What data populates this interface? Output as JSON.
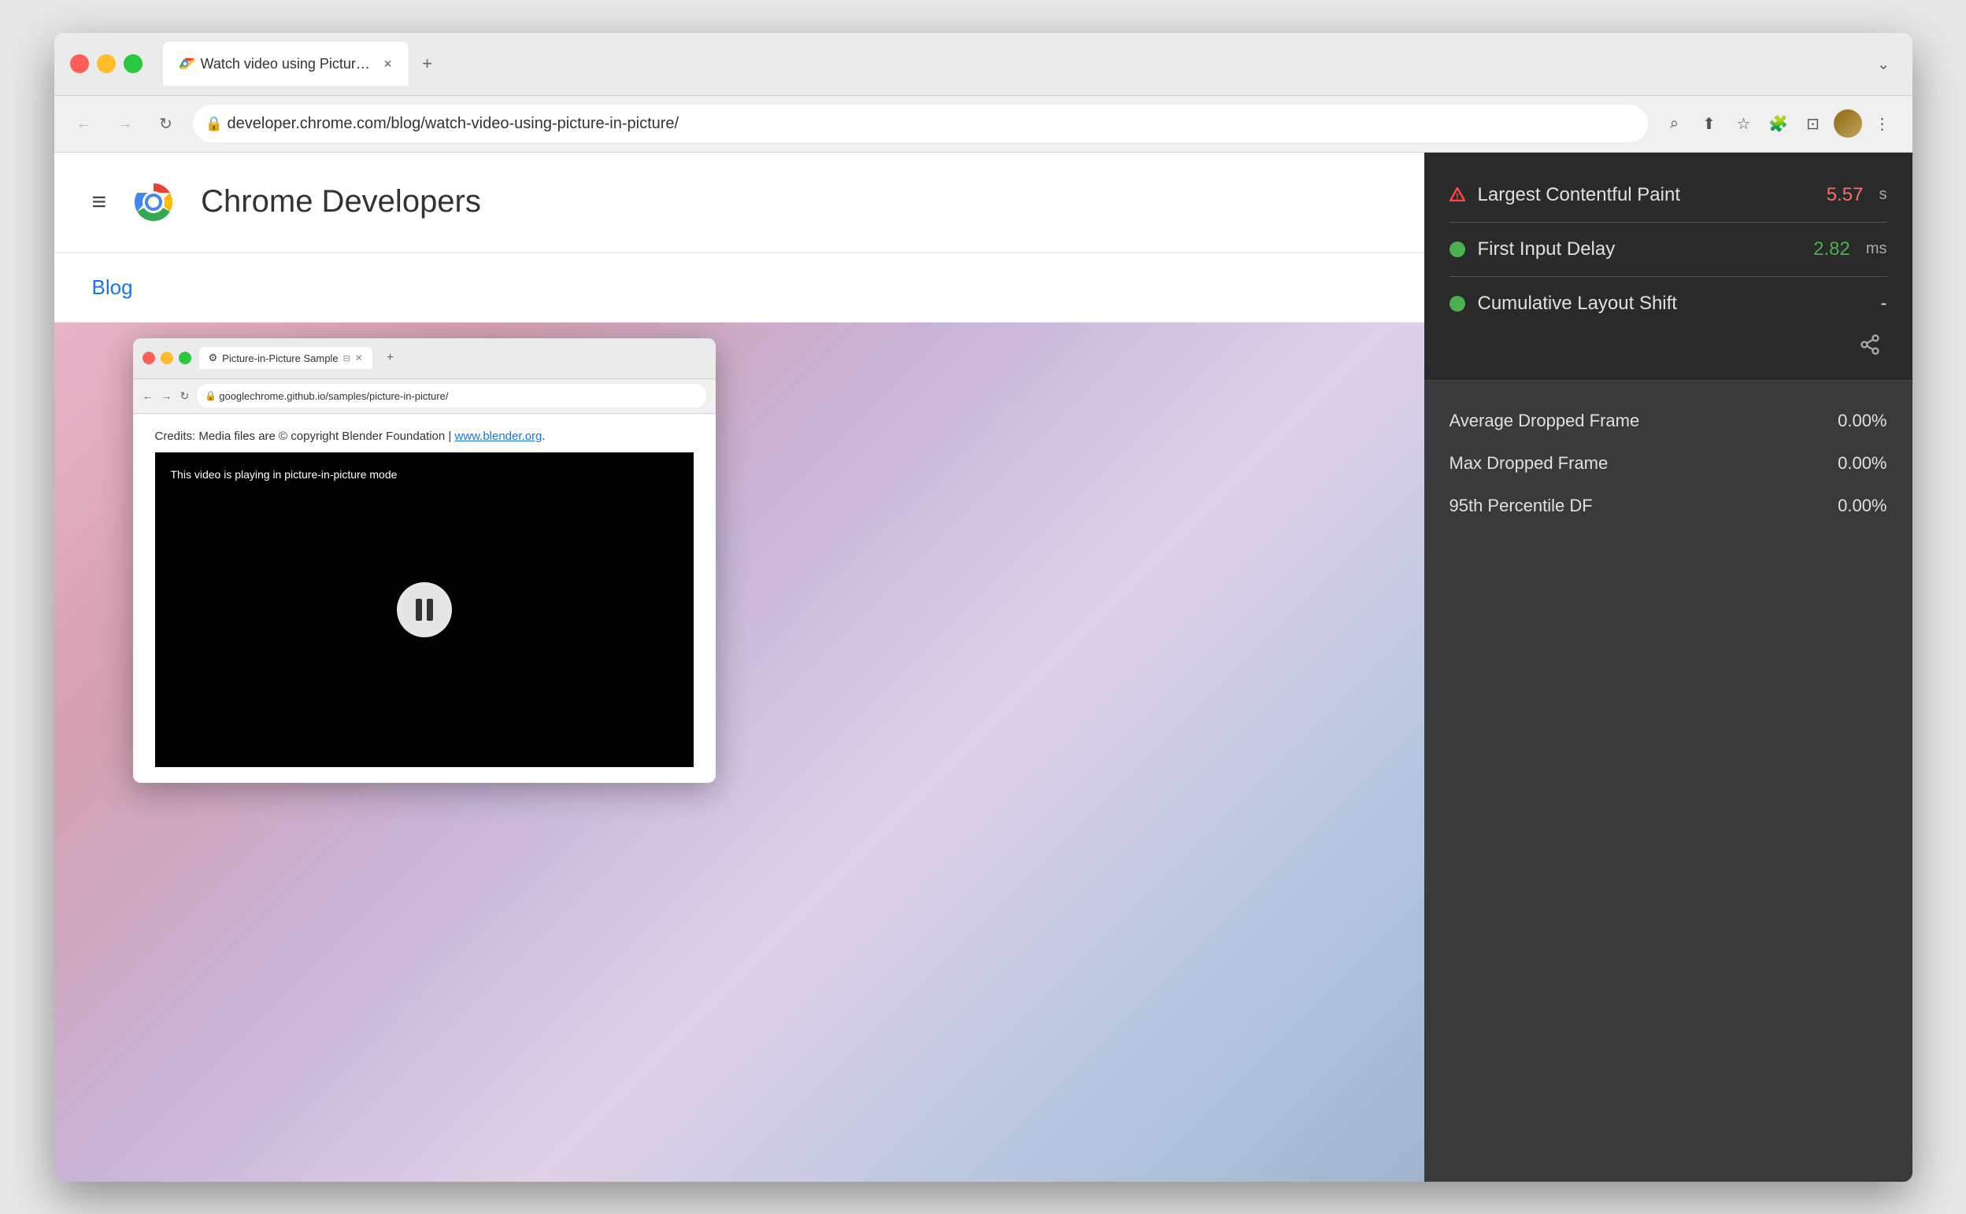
{
  "browser": {
    "tab": {
      "title": "Watch video using Picture-in-P",
      "favicon": "chrome"
    },
    "address": "developer.chrome.com/blog/watch-video-using-picture-in-picture/",
    "new_tab_label": "+",
    "menu_label": "⋮"
  },
  "site": {
    "title": "Chrome Developers",
    "blog_link": "Blog"
  },
  "inner_browser": {
    "tab": {
      "title": "Picture-in-Picture Sample",
      "favicon": "⚙"
    },
    "address": "googlechrome.github.io/samples/picture-in-picture/",
    "credits_text": "Credits: Media files are © copyright Blender Foundation | ",
    "credits_link": "www.blender.org",
    "credits_period": ".",
    "video_text": "This video is playing in picture-in-picture mode"
  },
  "metrics": {
    "cwv": [
      {
        "name": "Largest Contentful Paint",
        "indicator": "triangle",
        "value": "5.57",
        "unit": "s",
        "status": "bad"
      },
      {
        "name": "First Input Delay",
        "indicator": "circle-green",
        "value": "2.82",
        "unit": "ms",
        "status": "good"
      },
      {
        "name": "Cumulative Layout Shift",
        "indicator": "circle-green",
        "value": "-",
        "unit": "",
        "status": "neutral"
      }
    ],
    "frames": [
      {
        "name": "Average Dropped Frame",
        "value": "0.00%"
      },
      {
        "name": "Max Dropped Frame",
        "value": "0.00%"
      },
      {
        "name": "95th Percentile DF",
        "value": "0.00%"
      }
    ]
  },
  "icons": {
    "back": "←",
    "forward": "→",
    "reload": "↻",
    "search": "⌕",
    "share": "⬆",
    "bookmark": "☆",
    "extension": "🧩",
    "window": "⊡",
    "lock": "🔒",
    "share_metrics": "⇥",
    "hamburger": "≡",
    "tab_view": "⊟"
  }
}
